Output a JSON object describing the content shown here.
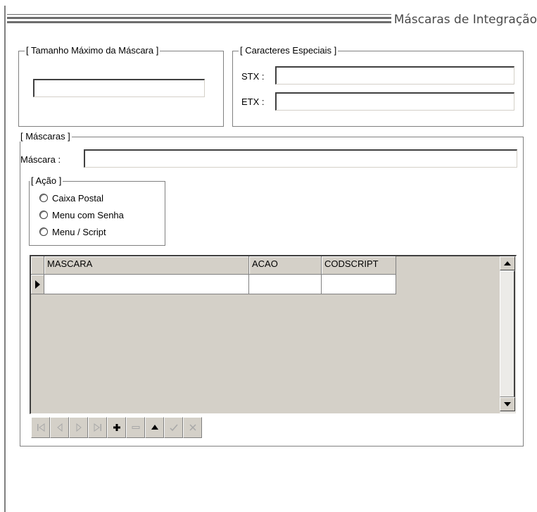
{
  "window": {
    "title": "Máscaras de Integração"
  },
  "tamanho_group": {
    "legend": "[ Tamanho Máximo da Máscara ]",
    "value": ""
  },
  "caracteres_group": {
    "legend": "[ Caracteres Especiais ]",
    "stx_label": "STX :",
    "stx_value": "",
    "etx_label": "ETX :",
    "etx_value": ""
  },
  "mascaras_group": {
    "legend": "[ Máscaras ]",
    "mascara_label": "Máscara :",
    "mascara_value": "",
    "acao_group": {
      "legend": "[ Ação ]",
      "options": [
        "Caixa Postal",
        "Menu com Senha",
        "Menu / Script"
      ]
    }
  },
  "grid": {
    "columns": [
      "MASCARA",
      "ACAO",
      "CODSCRIPT"
    ],
    "rows": [
      [
        "",
        "",
        ""
      ]
    ]
  },
  "navigator": {
    "buttons": [
      {
        "icon": "first-record-icon",
        "enabled": false
      },
      {
        "icon": "prior-record-icon",
        "enabled": false
      },
      {
        "icon": "next-record-icon",
        "enabled": false
      },
      {
        "icon": "last-record-icon",
        "enabled": false
      },
      {
        "icon": "insert-record-icon",
        "enabled": true
      },
      {
        "icon": "delete-record-icon",
        "enabled": false
      },
      {
        "icon": "edit-record-icon",
        "enabled": true
      },
      {
        "icon": "post-record-icon",
        "enabled": false
      },
      {
        "icon": "cancel-record-icon",
        "enabled": false
      }
    ]
  },
  "colors": {
    "face": "#d4d0c8",
    "shadow": "#808080",
    "dark_shadow": "#404040",
    "title_text": "#4a4a4a"
  }
}
